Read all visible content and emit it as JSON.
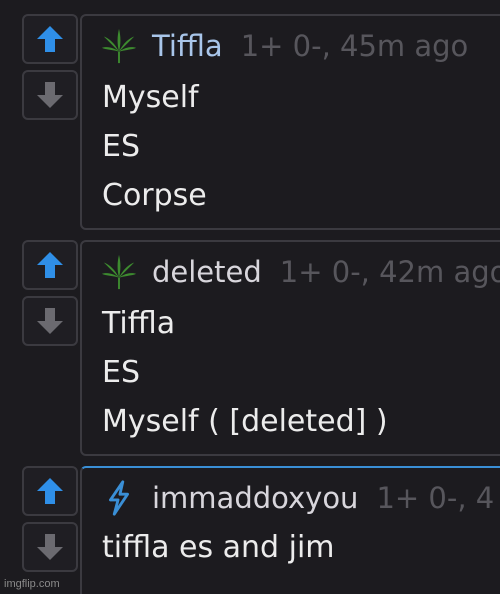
{
  "colors": {
    "background": "#1c1b1f",
    "border": "#3b3a40",
    "upvote_active": "#2f8fe8",
    "downvote": "#6b6a70",
    "author_link": "#a9c6ea",
    "meta": "#57565c",
    "leaf_icon": "#3d8b2f",
    "bolt_icon": "#3a8fd6",
    "highlight_border": "#3a8fd6"
  },
  "comments": [
    {
      "author_icon": "cannabis-leaf-icon",
      "author": "Tiffla",
      "meta": "1+ 0-, 45m ago",
      "lines": [
        "Myself",
        "ES",
        "Corpse"
      ]
    },
    {
      "author_icon": "cannabis-leaf-icon",
      "author": "deleted",
      "meta": "1+ 0-, 42m ago",
      "lines": [
        "Tiffla",
        "ES",
        "Myself ( [deleted] )"
      ]
    },
    {
      "author_icon": "lightning-bolt-icon",
      "author": "immaddoxyou",
      "meta": "1+ 0-, 4",
      "lines": [
        "tiffla es and jim"
      ]
    }
  ],
  "watermark": "imgflip.com"
}
